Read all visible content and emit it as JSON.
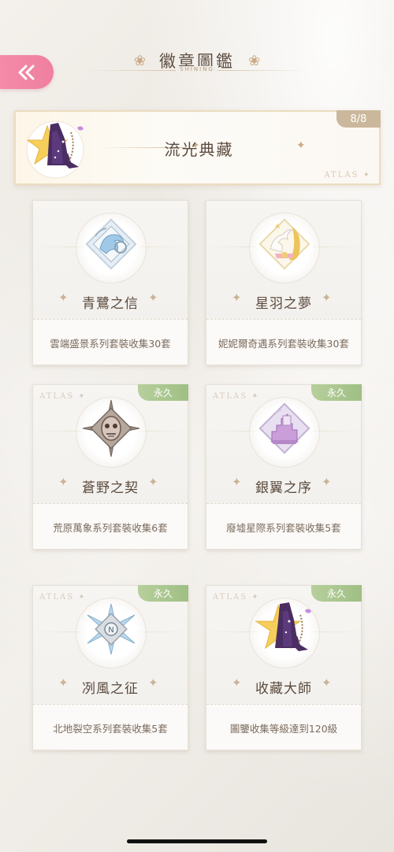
{
  "header": {
    "title": "徽章圖鑑",
    "subtitle": "SHINING"
  },
  "banner": {
    "title": "流光典藏",
    "count": "8/8",
    "watermark": "ATLAS ✦"
  },
  "cards": [
    {
      "name": "青鷺之信",
      "desc": "雲端盛景系列套裝收集30套",
      "perm": "",
      "atlas": "",
      "badge_icon": "heron-badge-icon"
    },
    {
      "name": "星羽之夢",
      "desc": "妮妮爾奇遇系列套裝收集30套",
      "perm": "",
      "atlas": "",
      "badge_icon": "swan-badge-icon"
    },
    {
      "name": "蒼野之契",
      "desc": "荒原萬象系列套裝收集6套",
      "perm": "永久",
      "atlas": "ATLAS ✦",
      "badge_icon": "mask-badge-icon"
    },
    {
      "name": "銀翼之序",
      "desc": "廢墟星際系列套裝收集5套",
      "perm": "永久",
      "atlas": "ATLAS ✦",
      "badge_icon": "city-badge-icon"
    },
    {
      "name": "冽風之征",
      "desc": "北地裂空系列套裝收集5套",
      "perm": "永久",
      "atlas": "ATLAS ✦",
      "badge_icon": "compass-badge-icon"
    },
    {
      "name": "收藏大師",
      "desc": "圖鑒收集等級達到120級",
      "perm": "永久",
      "atlas": "ATLAS ✦",
      "badge_icon": "dress-star-badge-icon"
    }
  ],
  "colors": {
    "accent_pink": "#f48aa8",
    "perm_green": "#a9c58e",
    "gold": "#c9ab86"
  }
}
